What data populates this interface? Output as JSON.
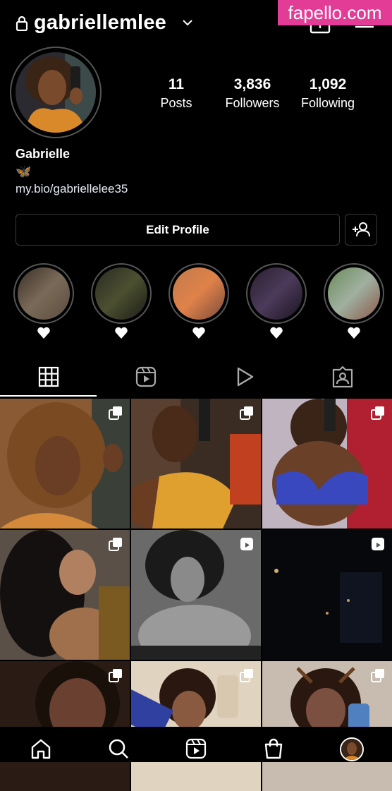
{
  "watermark": "fapello.com",
  "header": {
    "username": "gabriellemlee"
  },
  "profile": {
    "stats": [
      {
        "value": "11",
        "label": "Posts"
      },
      {
        "value": "3,836",
        "label": "Followers"
      },
      {
        "value": "1,092",
        "label": "Following"
      }
    ],
    "display_name": "Gabrielle",
    "bio_emoji": "🦋",
    "link": "my.bio/gabriellelee35",
    "edit_label": "Edit Profile"
  },
  "highlights": 5,
  "tabs": [
    "grid-icon",
    "reels-icon",
    "video-icon",
    "tagged-icon"
  ],
  "grid": [
    {
      "badge": "carousel-icon",
      "bg": "#8a5a35"
    },
    {
      "badge": "carousel-icon",
      "bg": "#a8762a"
    },
    {
      "badge": "carousel-icon",
      "bg": "#6a6fb2"
    },
    {
      "badge": "carousel-icon",
      "bg": "#54483c"
    },
    {
      "badge": "reel-icon",
      "bg": "#3e3e3e"
    },
    {
      "badge": "reel-icon",
      "bg": "#07080c"
    },
    {
      "badge": "carousel-icon",
      "bg": "#4c3526"
    },
    {
      "badge": "carousel-icon",
      "bg": "#8a5d44"
    },
    {
      "badge": "carousel-icon",
      "bg": "#7c5a46"
    }
  ],
  "nav": [
    "home-icon",
    "search-icon",
    "reels-icon",
    "shop-icon",
    "profile-avatar"
  ]
}
